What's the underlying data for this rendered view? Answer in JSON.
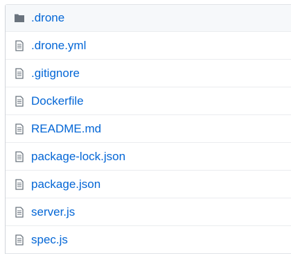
{
  "files": [
    {
      "name": ".drone",
      "type": "directory",
      "icon": "folder-icon"
    },
    {
      "name": ".drone.yml",
      "type": "file",
      "icon": "file-icon"
    },
    {
      "name": ".gitignore",
      "type": "file",
      "icon": "file-icon"
    },
    {
      "name": "Dockerfile",
      "type": "file",
      "icon": "file-icon"
    },
    {
      "name": "README.md",
      "type": "file",
      "icon": "file-icon"
    },
    {
      "name": "package-lock.json",
      "type": "file",
      "icon": "file-icon"
    },
    {
      "name": "package.json",
      "type": "file",
      "icon": "file-icon"
    },
    {
      "name": "server.js",
      "type": "file",
      "icon": "file-icon"
    },
    {
      "name": "spec.js",
      "type": "file",
      "icon": "file-icon"
    }
  ],
  "colors": {
    "link": "#0366d6",
    "folder_icon": "#79b8ff",
    "file_icon": "#6a737d",
    "row_border": "#eaecef",
    "highlight_row": "#f6f8fa"
  }
}
